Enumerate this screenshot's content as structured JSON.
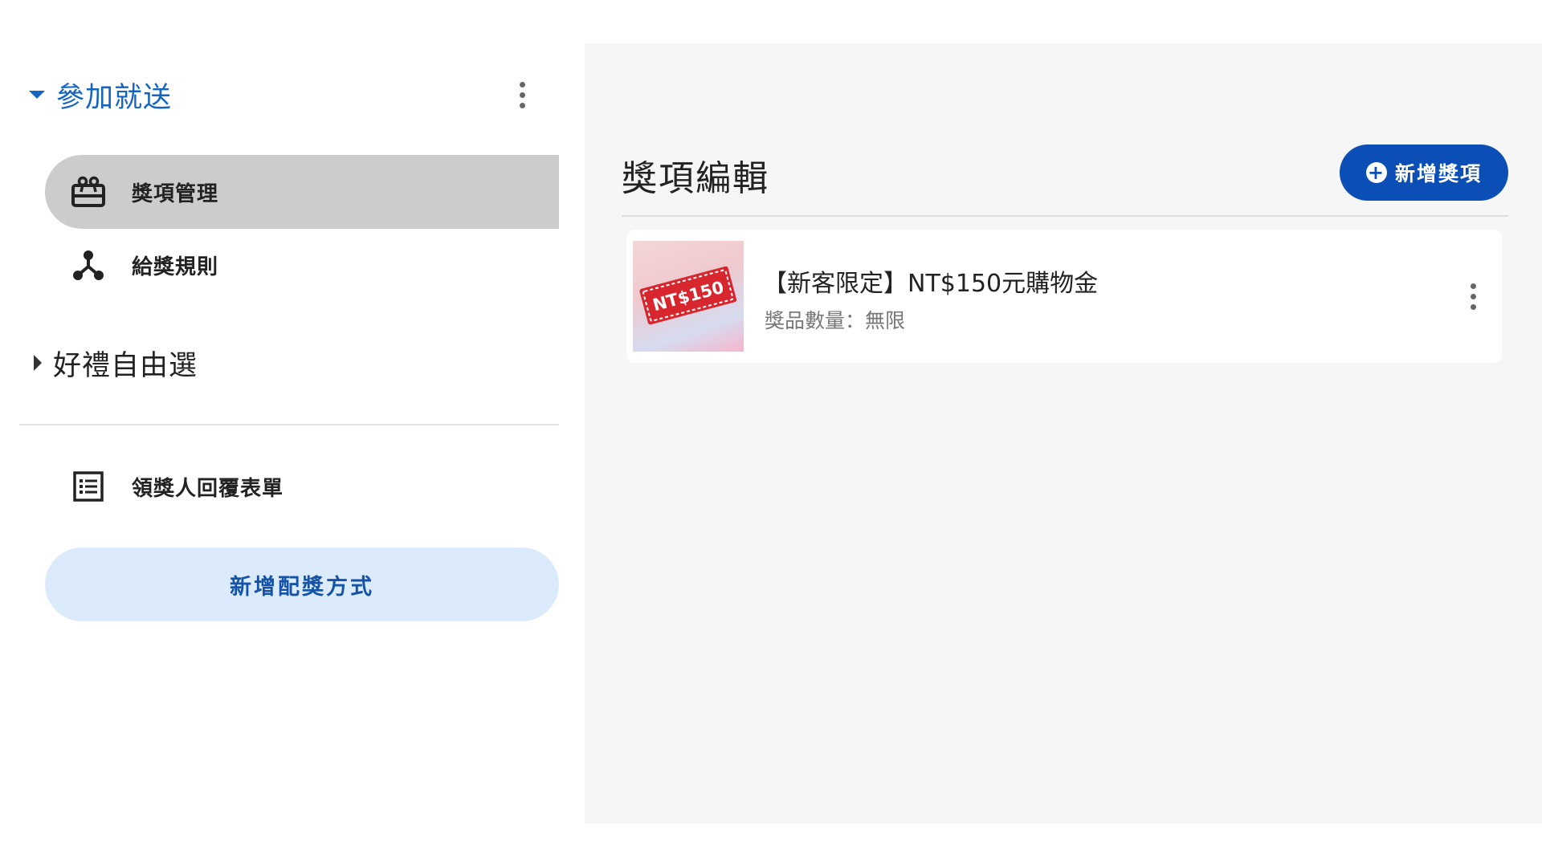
{
  "sidebar": {
    "groups": [
      {
        "title": "參加就送",
        "expanded": true,
        "items": [
          {
            "label": "獎項管理",
            "icon": "gift-box-icon",
            "selected": true
          },
          {
            "label": "給獎規則",
            "icon": "branch-icon",
            "selected": false
          }
        ]
      },
      {
        "title": "好禮自由選",
        "expanded": false
      }
    ],
    "form_item": {
      "label": "領獎人回覆表單",
      "icon": "list-form-icon"
    },
    "add_method_label": "新增配獎方式"
  },
  "main": {
    "title": "獎項編輯",
    "add_prize_label": "新增獎項",
    "prizes": [
      {
        "name": "【新客限定】NT$150元購物金",
        "quantity_text": "獎品數量：無限",
        "thumbnail_text": "NT$150"
      }
    ]
  },
  "colors": {
    "accent": "#1565c0",
    "primary_button": "#0b4fb6",
    "selected_bg": "#cccccc",
    "secondary_button_bg": "#dcebfb",
    "main_bg": "#f6f6f6"
  }
}
